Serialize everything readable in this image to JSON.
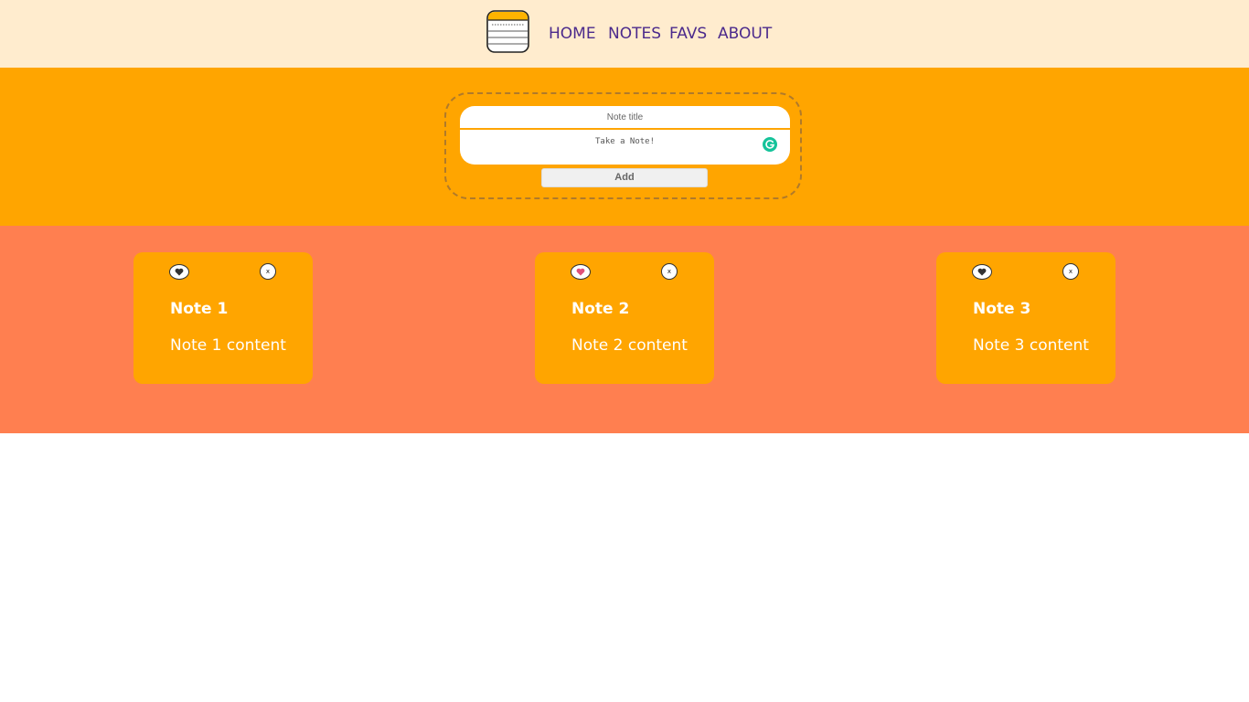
{
  "nav": {
    "logo_icon": "notepad-icon",
    "links": [
      {
        "label": "HOME"
      },
      {
        "label": "NOTES"
      },
      {
        "label": "FAVS"
      },
      {
        "label": "ABOUT"
      }
    ]
  },
  "form": {
    "title_placeholder": "Note title",
    "note_placeholder": "Take a Note!",
    "add_label": "Add",
    "grammar_icon": "grammarly-icon"
  },
  "notes": [
    {
      "title": "Note 1",
      "content": "Note 1 content",
      "favorited": false,
      "delete_label": "x"
    },
    {
      "title": "Note 2",
      "content": "Note 2 content",
      "favorited": true,
      "delete_label": "x"
    },
    {
      "title": "Note 3",
      "content": "Note 3 content",
      "favorited": false,
      "delete_label": "x"
    }
  ],
  "colors": {
    "navbar_bg": "#ffecce",
    "nav_text": "#4b2a8c",
    "form_band_bg": "#ffa500",
    "notes_band_bg": "#ff7f50",
    "card_bg": "#ffa500",
    "fav_heart": "#e0507a",
    "heart": "#333333"
  }
}
